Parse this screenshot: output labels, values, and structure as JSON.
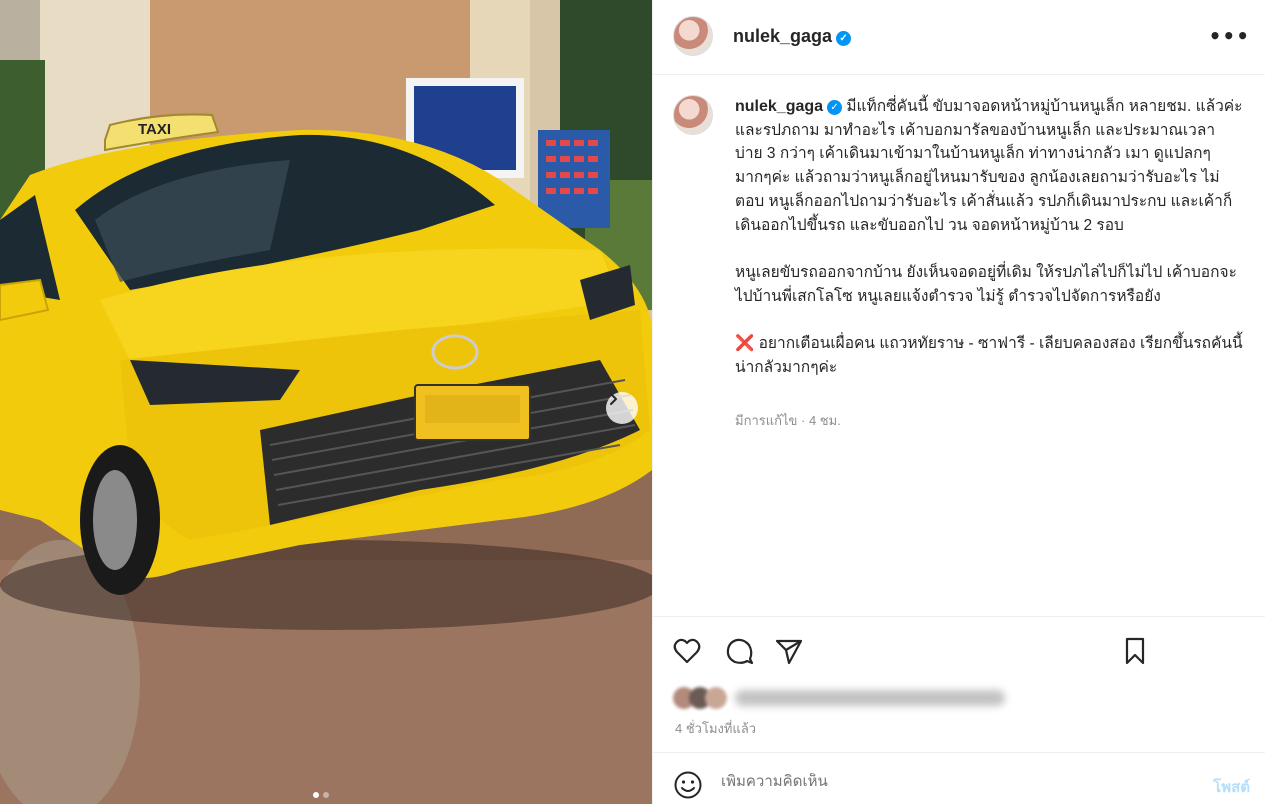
{
  "post": {
    "username": "nulek_gaga",
    "verified": true,
    "caption_paragraphs": [
      "มีแท็กซี่คันนี้ ขับมาจอดหน้าหมู่บ้านหนูเล็ก หลายชม. แล้วค่ะ และรปภถาม มาทำอะไร เค้าบอกมารัลของบ้านหนูเล็ก และประมาณเวลา บ่าย 3 กว่าๆ เค้าเดินมาเข้ามาในบ้านหนูเล็ก ท่าทางน่ากลัว เมา ดูแปลกๆมากๆค่ะ แล้วถามว่าหนูเล็กอยู่ไหนมารับของ ลูกน้องเลยถามว่ารับอะไร ไม่ตอบ หนูเล็กออกไปถามว่ารับอะไร เค้าสั่นแล้ว รปภก็เดินมาประกบ และเค้าก็เดินออกไปขึ้นรถ และขับออกไป วน จอดหน้าหมู่บ้าน 2 รอบ",
      "หนูเลยขับรถออกจากบ้าน ยังเห็นจอดอยู่ที่เดิม ให้รปภไล่ไปก็ไม่ไป เค้าบอกจะไปบ้านพี่เสกโลโซ หนูเลยแจ้งตำรวจ ไม่รู้ ตำรวจไปจัดการหรือยัง",
      "อยากเตือนเผื่อคน แถวหทัยราษ - ซาฟารี - เลียบคลองสอง เรียกขึ้นรถคันนี้ น่ากลัวมากๆค่ะ"
    ],
    "warning_emoji": "❌",
    "edited_meta": "มีการแก้ไข · 4 ชม.",
    "time_ago": "4 ชั่วโมงที่แล้ว",
    "more_icon": "•••"
  },
  "media": {
    "taxi_sign": "TAXI",
    "slide_count": 2,
    "active_slide": 1
  },
  "comment": {
    "placeholder": "เพิ่มความคิดเห็น",
    "post_label": "โพสต์"
  },
  "icons": [
    "heart-icon",
    "comment-icon",
    "share-icon",
    "save-icon",
    "emoji-icon",
    "chevron-right-icon",
    "more-icon",
    "verified-icon"
  ],
  "colors": {
    "accent": "#0095f6",
    "taxi_yellow": "#f2cc0c",
    "warning": "#d63031"
  }
}
